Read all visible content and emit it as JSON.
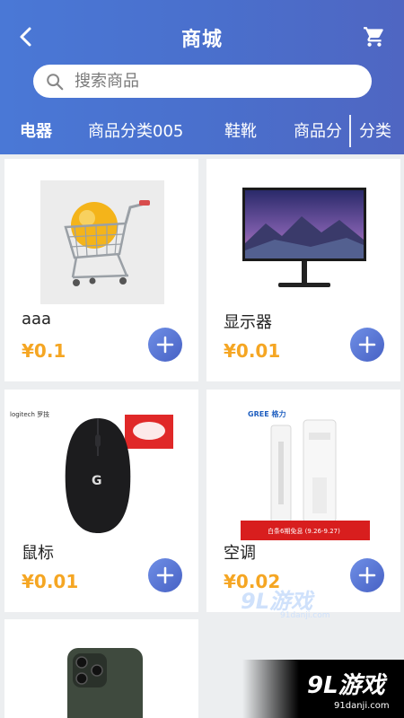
{
  "header": {
    "title": "商城"
  },
  "search": {
    "placeholder": "搜索商品"
  },
  "tabs": [
    {
      "label": "电器"
    },
    {
      "label": "商品分类005"
    },
    {
      "label": "鞋靴"
    },
    {
      "label": "商品分"
    }
  ],
  "category_button": "分类",
  "products": [
    {
      "name": "aaa",
      "price": "¥0.1"
    },
    {
      "name": "显示器",
      "price": "¥0.01"
    },
    {
      "name": "鼠标",
      "price": "¥0.01"
    },
    {
      "name": "空调",
      "price": "¥0.02"
    },
    {
      "name": "",
      "price": ""
    }
  ],
  "mouse_box_text": "logitech 罗技",
  "ac_brand": "GREE 格力",
  "ac_banner": "白条6期免息 (9.26-9.27)",
  "watermark": {
    "main": "9L游戏",
    "sub": "91danji.com"
  },
  "bottom_logo": {
    "main": "9L游戏",
    "sub": "91danji.com"
  },
  "colors": {
    "header": "#4a6fcc",
    "price": "#f5a623",
    "add_button": "#4761c4"
  }
}
